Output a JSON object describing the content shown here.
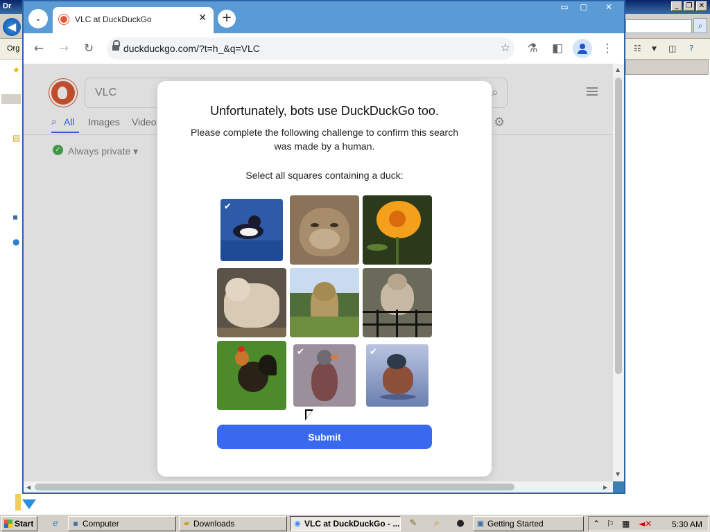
{
  "background_window": {
    "title": "Dr",
    "toolbar_label": "Org"
  },
  "browser": {
    "tab_title": "VLC at DuckDuckGo",
    "url": "duckduckgo.com/?t=h_&q=VLC"
  },
  "search": {
    "query": "VLC",
    "tabs": [
      "All",
      "Images",
      "Video"
    ],
    "privacy_label": "Always private ▾"
  },
  "challenge": {
    "title": "Unfortunately, bots use DuckDuckGo too.",
    "description": "Please complete the following challenge to confirm this search was made by a human.",
    "prompt": "Select all squares containing a duck:",
    "submit_label": "Submit",
    "tiles": [
      {
        "subject": "duck",
        "selected": true
      },
      {
        "subject": "cat",
        "selected": false
      },
      {
        "subject": "lily",
        "selected": false
      },
      {
        "subject": "bear",
        "selected": false
      },
      {
        "subject": "cheetah",
        "selected": false
      },
      {
        "subject": "squirrel",
        "selected": false
      },
      {
        "subject": "rooster",
        "selected": false
      },
      {
        "subject": "duck",
        "selected": true
      },
      {
        "subject": "duck",
        "selected": true
      }
    ]
  },
  "taskbar": {
    "start_label": "Start",
    "buttons": [
      {
        "label": "Computer"
      },
      {
        "label": "Downloads"
      },
      {
        "label": "VLC at DuckDuckGo - ..."
      },
      {
        "label": "Getting Started"
      }
    ],
    "clock": "5:30 AM"
  },
  "colors": {
    "accent": "#3969ef",
    "ddg_orange": "#de5833",
    "titlebar": "#5b9bd5"
  }
}
